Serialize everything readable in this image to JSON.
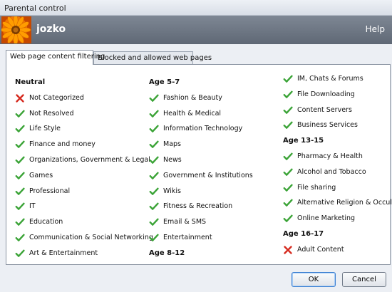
{
  "window": {
    "title": "Parental control"
  },
  "header": {
    "username": "jozko",
    "help": "Help"
  },
  "tabs": [
    {
      "label": "Web page content filtering",
      "active": true
    },
    {
      "label": "Blocked and allowed web pages",
      "active": false
    }
  ],
  "columns": [
    {
      "groups": [
        {
          "heading": "Neutral",
          "items": [
            {
              "label": "Not Categorized",
              "status": "blocked"
            },
            {
              "label": "Not Resolved",
              "status": "allowed"
            },
            {
              "label": "Life Style",
              "status": "allowed"
            },
            {
              "label": "Finance and money",
              "status": "allowed"
            },
            {
              "label": "Organizations, Government & Legal",
              "status": "allowed"
            },
            {
              "label": "Games",
              "status": "allowed"
            },
            {
              "label": "Professional",
              "status": "allowed"
            },
            {
              "label": "IT",
              "status": "allowed"
            },
            {
              "label": "Education",
              "status": "allowed"
            },
            {
              "label": "Communication & Social Networking",
              "status": "allowed"
            },
            {
              "label": "Art & Entertainment",
              "status": "allowed"
            }
          ]
        }
      ]
    },
    {
      "groups": [
        {
          "heading": "Age 5-7",
          "items": [
            {
              "label": "Fashion & Beauty",
              "status": "allowed"
            },
            {
              "label": "Health & Medical",
              "status": "allowed"
            },
            {
              "label": "Information Technology",
              "status": "allowed"
            },
            {
              "label": "Maps",
              "status": "allowed"
            },
            {
              "label": "News",
              "status": "allowed"
            },
            {
              "label": "Government & Institutions",
              "status": "allowed"
            },
            {
              "label": "Wikis",
              "status": "allowed"
            },
            {
              "label": "Fitness & Recreation",
              "status": "allowed"
            },
            {
              "label": "Email & SMS",
              "status": "allowed"
            },
            {
              "label": "Entertainment",
              "status": "allowed"
            }
          ]
        },
        {
          "heading": "Age 8-12",
          "items": []
        }
      ]
    },
    {
      "groups": [
        {
          "heading": "",
          "items": [
            {
              "label": "IM, Chats & Forums",
              "status": "allowed"
            },
            {
              "label": "File Downloading",
              "status": "allowed"
            },
            {
              "label": "Content Servers",
              "status": "allowed"
            },
            {
              "label": "Business Services",
              "status": "allowed"
            }
          ]
        },
        {
          "heading": "Age 13-15",
          "items": [
            {
              "label": "Pharmacy & Health",
              "status": "allowed"
            },
            {
              "label": "Alcohol and Tobacco",
              "status": "allowed"
            },
            {
              "label": "File sharing",
              "status": "allowed"
            },
            {
              "label": "Alternative Religion & Occult",
              "status": "allowed"
            },
            {
              "label": "Online Marketing",
              "status": "allowed"
            }
          ]
        },
        {
          "heading": "Age 16-17",
          "items": [
            {
              "label": "Adult Content",
              "status": "blocked"
            }
          ]
        }
      ]
    }
  ],
  "buttons": {
    "ok": "OK",
    "cancel": "Cancel"
  },
  "colors": {
    "allowed": "#3aa336",
    "blocked": "#d62a1f"
  }
}
